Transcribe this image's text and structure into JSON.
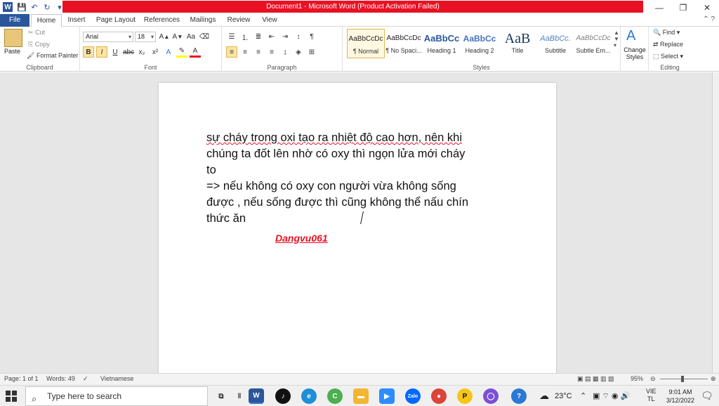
{
  "window": {
    "title": "Document1  -  Microsoft Word (Product Activation Failed)",
    "logo_letter": "W"
  },
  "tabs": [
    {
      "label": "File"
    },
    {
      "label": "Home"
    },
    {
      "label": "Insert"
    },
    {
      "label": "Page Layout"
    },
    {
      "label": "References"
    },
    {
      "label": "Mailings"
    },
    {
      "label": "Review"
    },
    {
      "label": "View"
    }
  ],
  "clipboard": {
    "paste": "Paste",
    "cut": "Cut",
    "copy": "Copy",
    "format_painter": "Format Painter",
    "label": "Clipboard"
  },
  "font": {
    "name": "Arial",
    "size": "18",
    "label": "Font"
  },
  "paragraph": {
    "label": "Paragraph"
  },
  "styles": {
    "label": "Styles",
    "items": [
      {
        "preview": "AaBbCcDc",
        "name": "¶ Normal"
      },
      {
        "preview": "AaBbCcDc",
        "name": "¶ No Spaci..."
      },
      {
        "preview": "AaBbCc",
        "name": "Heading 1"
      },
      {
        "preview": "AaBbCc",
        "name": "Heading 2"
      },
      {
        "preview": "AaB",
        "name": "Title"
      },
      {
        "preview": "AaBbCc.",
        "name": "Subtitle"
      },
      {
        "preview": "AaBbCcDc",
        "name": "Subtle Em..."
      }
    ],
    "change_styles": "Change Styles"
  },
  "editing": {
    "find": "Find",
    "replace": "Replace",
    "select": "Select",
    "label": "Editing"
  },
  "document": {
    "lines": [
      "sự cháy trong oxi tạo ra nhiệt độ cao hơn, nên khi",
      "chúng ta đốt lên nhờ có oxy  thì ngọn lửa mới cháy",
      "to",
      "=> nếu không có oxy  con người vừa không sống",
      "được , nếu sống được thì cũng không thể nấu chín",
      "thức ăn"
    ],
    "author": "Dangvu061"
  },
  "status": {
    "page": "Page: 1 of 1",
    "words": "Words: 49",
    "language": "Vietnamese",
    "zoom": "95%"
  },
  "taskbar": {
    "search_placeholder": "Type here to search",
    "weather": "23°C",
    "lang": "VIE",
    "lang_sub": "TL",
    "time": "9:01 AM",
    "date": "3/12/2022",
    "zalo": "Zalo"
  }
}
